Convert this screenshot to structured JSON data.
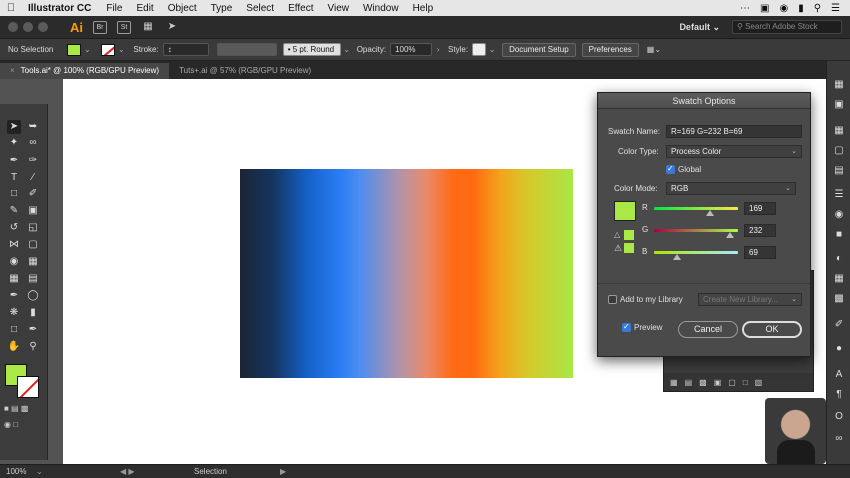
{
  "menubar": {
    "app": "Illustrator CC",
    "items": [
      "File",
      "Edit",
      "Object",
      "Type",
      "Select",
      "Effect",
      "View",
      "Window",
      "Help"
    ]
  },
  "appbar": {
    "logo": "Ai",
    "btn_br": "Br",
    "btn_st": "St",
    "workspace": "Default",
    "stock_placeholder": "Search Adobe Stock"
  },
  "control": {
    "selection": "No Selection",
    "stroke_label": "Stroke:",
    "brush": "5 pt. Round",
    "opacity_label": "Opacity:",
    "opacity_value": "100%",
    "style_label": "Style:",
    "doc_setup": "Document Setup",
    "preferences": "Preferences",
    "colors": {
      "fill": "#a9e845",
      "stroke": "#ffffff"
    }
  },
  "tabs": [
    {
      "label": "Tools.ai* @ 100% (RGB/GPU Preview)",
      "active": true
    },
    {
      "label": "Tuts+.ai @ 57% (RGB/GPU Preview)",
      "active": false
    }
  ],
  "dialog": {
    "title": "Swatch Options",
    "swatch_name_label": "Swatch Name:",
    "swatch_name_value": "R=169 G=232 B=69",
    "color_type_label": "Color Type:",
    "color_type_value": "Process Color",
    "global_label": "Global",
    "global_checked": true,
    "color_mode_label": "Color Mode:",
    "color_mode_value": "RGB",
    "swatch_color": "#a9e845",
    "channels": [
      {
        "label": "R",
        "value": "169",
        "fraction": 0.663
      },
      {
        "label": "G",
        "value": "232",
        "fraction": 0.91
      },
      {
        "label": "B",
        "value": "69",
        "fraction": 0.27
      }
    ],
    "add_library_label": "Add to my Library",
    "create_library": "Create New Library...",
    "preview_label": "Preview",
    "preview_checked": true,
    "cancel": "Cancel",
    "ok": "OK"
  },
  "status": {
    "zoom": "100%",
    "mode": "Selection"
  }
}
